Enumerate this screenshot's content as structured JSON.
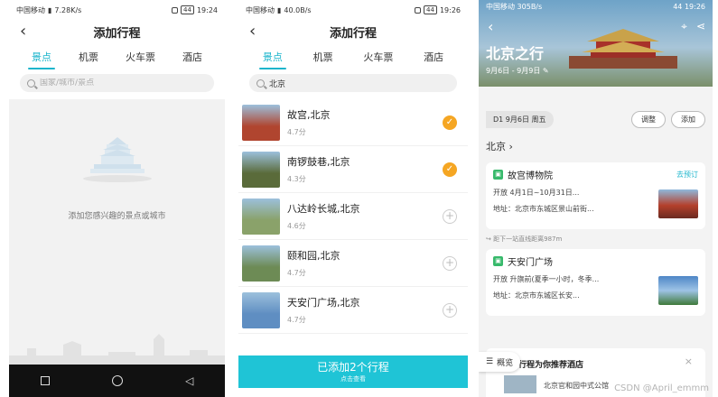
{
  "colors": {
    "accent": "#1bb5cc",
    "check": "#f5a623",
    "added_bar": "#1fc4d6",
    "green_badge": "#37b96b"
  },
  "panel1": {
    "status": {
      "carrier": "中国移动",
      "speed": "7.28K/s",
      "battery": "44",
      "time": "19:24"
    },
    "title": "添加行程",
    "tabs": [
      "景点",
      "机票",
      "火车票",
      "酒店"
    ],
    "active_tab": 0,
    "search_placeholder": "国家/城市/景点",
    "empty_message": "添加您感兴趣的景点或城市",
    "icons": {
      "back": "back-arrow-icon",
      "search": "search-icon",
      "illustration": "temple-of-heaven-icon"
    }
  },
  "panel2": {
    "status": {
      "carrier": "中国移动",
      "speed": "40.0B/s",
      "battery": "44",
      "time": "19:26"
    },
    "title": "添加行程",
    "tabs": [
      "景点",
      "机票",
      "火车票",
      "酒店"
    ],
    "active_tab": 0,
    "search_value": "北京",
    "results": [
      {
        "name": "故宫,北京",
        "score": "4.7分",
        "added": true,
        "thumb": "#b0452f"
      },
      {
        "name": "南锣鼓巷,北京",
        "score": "4.3分",
        "added": true,
        "thumb": "#5a6b3a"
      },
      {
        "name": "八达岭长城,北京",
        "score": "4.6分",
        "added": false,
        "thumb": "#8aa26a"
      },
      {
        "name": "颐和园,北京",
        "score": "4.7分",
        "added": false,
        "thumb": "#6d8b55"
      },
      {
        "name": "天安门广场,北京",
        "score": "4.7分",
        "added": false,
        "thumb": "#5f8ec2"
      }
    ],
    "added_bar": {
      "main": "已添加2个行程",
      "sub": "点击查看"
    }
  },
  "panel3": {
    "status": {
      "carrier": "中国移动",
      "speed": "305B/s",
      "battery": "44",
      "time": "19:26"
    },
    "trip_title": "北京之行",
    "dates": "9月6日 - 9月9日",
    "day_label": "D1 9月6日 周五",
    "adjust_label": "调整",
    "add_label": "添加",
    "city": "北京",
    "spots": [
      {
        "name": "故宫博物院",
        "link": "去预订",
        "hours": "开放 4月1日~10月31日...",
        "address": "地址：北京市东城区景山前街...",
        "img": "#b5402c"
      },
      {
        "name": "天安门广场",
        "link": "",
        "hours": "开放 升旗前(夏季一小时，冬季...",
        "address": "地址：北京市东城区长安...",
        "img": "#4d86c6"
      }
    ],
    "distance": "距下一站直线距离987m",
    "hotel_title": "行程为你推荐酒店",
    "hotel_name": "北京官和园中式公馆",
    "overview_label": "概览",
    "watermark": "CSDN @April_emmm"
  }
}
